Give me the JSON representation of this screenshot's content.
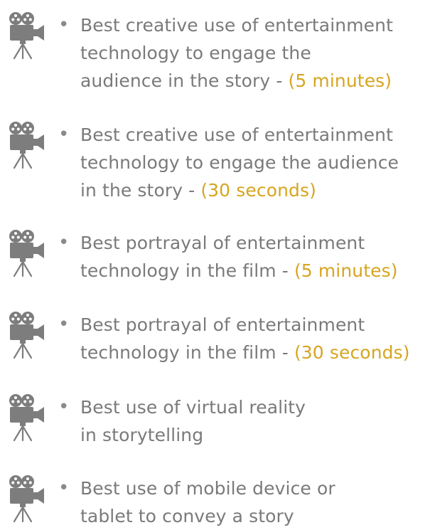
{
  "colors": {
    "text": "#7a7a7a",
    "duration": "#d6a520",
    "icon": "#7d7d7d"
  },
  "bullet_symbol": "•",
  "items": [
    {
      "icon": "movie-camera-icon",
      "lines": [
        "Best creative use of entertainment",
        "technology to engage the",
        "audience in the story - "
      ],
      "duration": "(5 minutes)"
    },
    {
      "icon": "movie-camera-icon",
      "lines": [
        "Best creative use of entertainment",
        "technology to engage the audience",
        "in the story - "
      ],
      "duration": "(30 seconds)"
    },
    {
      "icon": "movie-camera-icon",
      "lines": [
        "Best portrayal of entertainment",
        "technology in the film - "
      ],
      "duration": "(5 minutes)"
    },
    {
      "icon": "movie-camera-icon",
      "lines": [
        "Best portrayal of entertainment",
        "technology in the film - "
      ],
      "duration": "(30 seconds)"
    },
    {
      "icon": "movie-camera-icon",
      "lines": [
        "Best use of virtual reality",
        "in storytelling"
      ],
      "duration": ""
    },
    {
      "icon": "movie-camera-icon",
      "lines": [
        "Best use of mobile device or",
        "tablet to convey a story"
      ],
      "duration": ""
    }
  ]
}
